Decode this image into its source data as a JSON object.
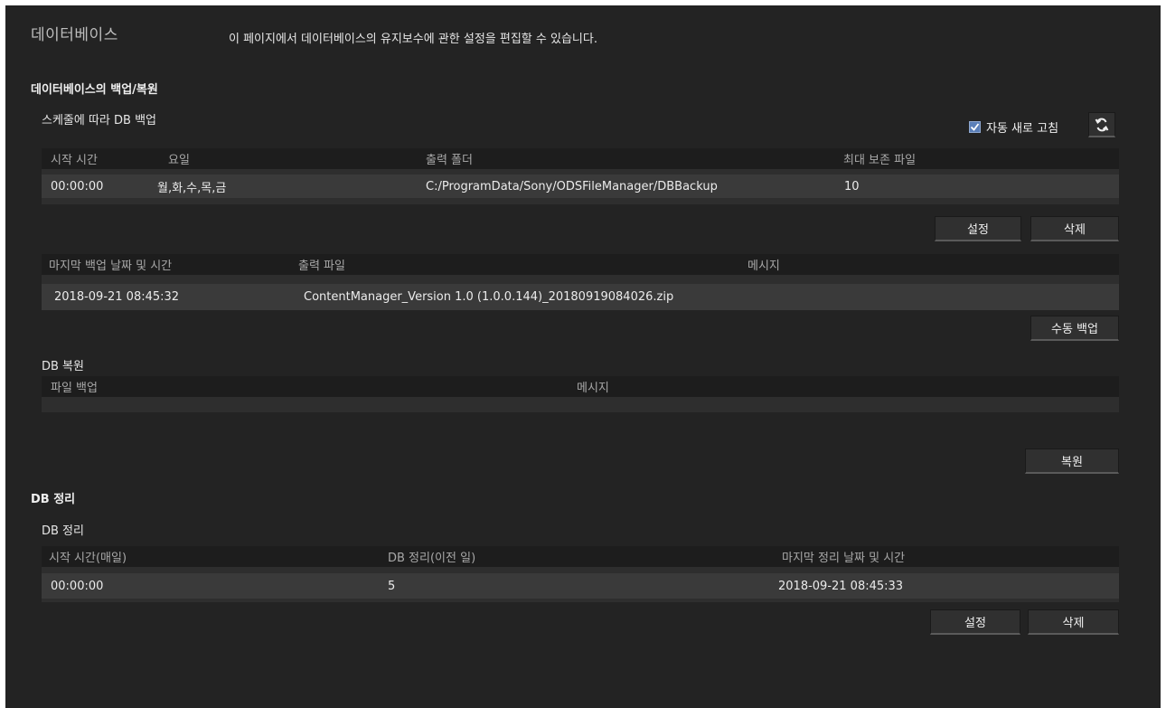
{
  "header": {
    "title": "데이터베이스",
    "description": "이 페이지에서 데이터베이스의 유지보수에 관한 설정을 편집할 수 있습니다."
  },
  "backup_restore": {
    "section_title": "데이터베이스의 백업/복원",
    "schedule_title": "스케줄에 따라 DB 백업",
    "auto_refresh_label": "자동 새로 고침",
    "auto_refresh_checked": true,
    "schedule_table": {
      "columns": [
        "시작 시간",
        "요일",
        "출력 폴더",
        "최대 보존 파일"
      ],
      "rows": [
        [
          "00:00:00",
          "월,화,수,목,금",
          "C:/ProgramData/Sony/ODSFileManager/DBBackup",
          "10"
        ]
      ]
    },
    "set_button": "설정",
    "delete_button": "삭제",
    "history_table": {
      "columns": [
        "마지막 백업 날짜 및 시간",
        "출력 파일",
        "메시지"
      ],
      "rows": [
        [
          "2018-09-21 08:45:32",
          "ContentManager_Version 1.0 (1.0.0.144)_20180919084026.zip",
          ""
        ]
      ]
    },
    "manual_backup_button": "수동 백업",
    "restore_title": "DB 복원",
    "restore_table": {
      "columns": [
        "파일 백업",
        "메시지"
      ]
    },
    "restore_button": "복원"
  },
  "cleanup": {
    "section_title": "DB 정리",
    "sub_title": "DB 정리",
    "table": {
      "columns": [
        "시작 시간(매일)",
        "DB 정리(이전 일)",
        "마지막 정리 날짜 및 시간"
      ],
      "rows": [
        [
          "00:00:00",
          "5",
          "2018-09-21 08:45:33"
        ]
      ]
    },
    "set_button": "설정",
    "delete_button": "삭제"
  },
  "colors": {
    "background": "#232323",
    "header_row": "#1d1d1d",
    "data_row": "#3a3a3a",
    "checkbox": "#5b7fb8"
  },
  "icons": {
    "checkbox": "check-icon",
    "refresh": "refresh-icon"
  }
}
